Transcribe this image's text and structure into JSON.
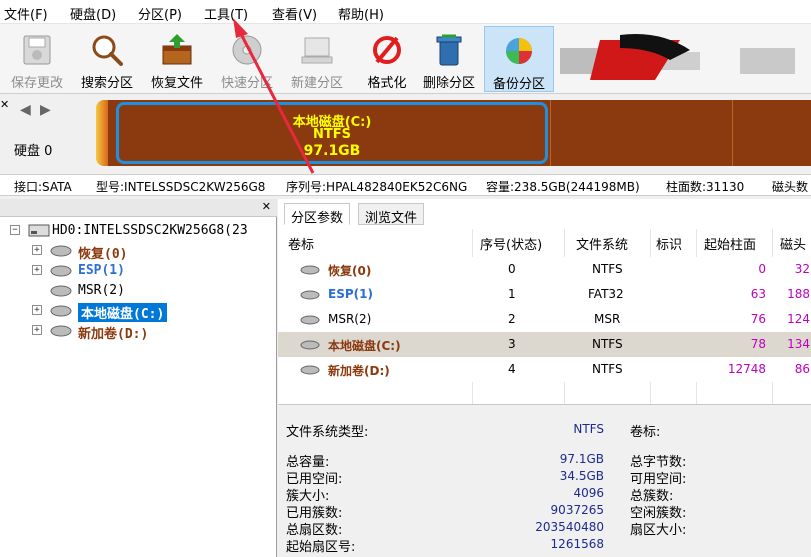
{
  "menu": [
    "文件(F)",
    "硬盘(D)",
    "分区(P)",
    "工具(T)",
    "查看(V)",
    "帮助(H)"
  ],
  "toolbar": [
    {
      "label": "保存更改",
      "icon": "save-icon",
      "state": "disabled"
    },
    {
      "label": "搜索分区",
      "icon": "search-magnifier-icon",
      "state": "normal"
    },
    {
      "label": "恢复文件",
      "icon": "recover-box-icon",
      "state": "normal"
    },
    {
      "label": "快速分区",
      "icon": "quick-partition-disc-icon",
      "state": "disabled"
    },
    {
      "label": "新建分区",
      "icon": "new-partition-icon",
      "state": "disabled"
    },
    {
      "label": "格式化",
      "icon": "format-icon",
      "state": "normal"
    },
    {
      "label": "删除分区",
      "icon": "trash-icon",
      "state": "normal"
    },
    {
      "label": "备份分区",
      "icon": "backup-icon",
      "state": "active"
    }
  ],
  "diskbar": {
    "disk_label": "硬盘 0",
    "partition_name": "本地磁盘(C:)",
    "partition_fs": "NTFS",
    "partition_size": "97.1GB"
  },
  "infobar": {
    "interface": "接口:SATA",
    "model": "型号:INTELSSDSC2KW256G8",
    "serial": "序列号:HPAL482840EK52C6NG",
    "capacity": "容量:238.5GB(244198MB)",
    "cylinders": "柱面数:31130",
    "heads": "磁头数"
  },
  "tree": {
    "disk": "HD0:INTELSSDSC2KW256G8(23",
    "items": [
      "恢复(0)",
      "ESP(1)",
      "MSR(2)",
      "本地磁盘(C:)",
      "新加卷(D:)"
    ]
  },
  "tabs": [
    "分区参数",
    "浏览文件"
  ],
  "table": {
    "headers": [
      "卷标",
      "序号(状态)",
      "文件系统",
      "标识",
      "起始柱面",
      "磁头"
    ],
    "rows": [
      {
        "name": "恢复(0)",
        "index": "0",
        "fs": "NTFS",
        "id": "",
        "start": "0",
        "head": "32"
      },
      {
        "name": "ESP(1)",
        "index": "1",
        "fs": "FAT32",
        "id": "",
        "start": "63",
        "head": "188"
      },
      {
        "name": "MSR(2)",
        "index": "2",
        "fs": "MSR",
        "id": "",
        "start": "76",
        "head": "124"
      },
      {
        "name": "本地磁盘(C:)",
        "index": "3",
        "fs": "NTFS",
        "id": "",
        "start": "78",
        "head": "134"
      },
      {
        "name": "新加卷(D:)",
        "index": "4",
        "fs": "NTFS",
        "id": "",
        "start": "12748",
        "head": "86"
      }
    ]
  },
  "details": {
    "fs_type_label": "文件系统类型:",
    "fs_type_value": "NTFS",
    "vol_label": "卷标:",
    "left": [
      {
        "label": "总容量:",
        "value": "97.1GB"
      },
      {
        "label": "已用空间:",
        "value": "34.5GB"
      },
      {
        "label": "簇大小:",
        "value": "4096"
      },
      {
        "label": "已用簇数:",
        "value": "9037265"
      },
      {
        "label": "总扇区数:",
        "value": "203540480"
      },
      {
        "label": "起始扇区号:",
        "value": "1261568"
      }
    ],
    "right": [
      "总字节数:",
      "可用空间:",
      "总簇数:",
      "空闲簇数:",
      "扇区大小:"
    ]
  },
  "colors": {
    "partition_brown": "#8b3a0f",
    "partition_label_yellow": "#ffff00",
    "selected_blue": "#0078d7",
    "value_magenta": "#c000c0",
    "arrow_red": "#e8283c"
  }
}
